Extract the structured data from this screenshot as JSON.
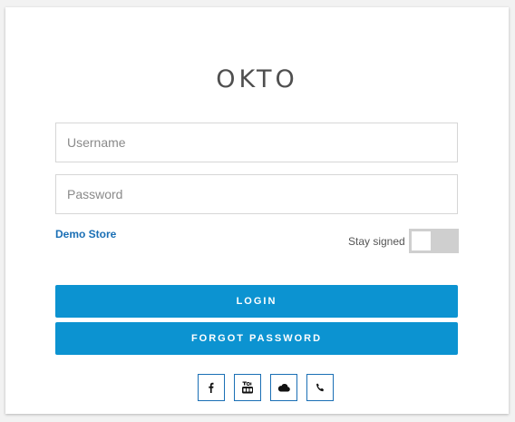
{
  "brand": {
    "logo": "OKTO"
  },
  "form": {
    "username_placeholder": "Username",
    "password_placeholder": "Password",
    "demo_store_label": "Demo Store",
    "stay_signed_label": "Stay signed",
    "stay_signed_on": false
  },
  "buttons": {
    "login_label": "LOGIN",
    "forgot_label": "FORGOT PASSWORD"
  },
  "socials": [
    {
      "icon": "facebook-icon"
    },
    {
      "icon": "youtube-icon"
    },
    {
      "icon": "cloud-icon"
    },
    {
      "icon": "phone-icon"
    }
  ],
  "colors": {
    "accent": "#0c93d1",
    "link": "#1a6fb5",
    "toggle_off": "#cfcfcf"
  }
}
